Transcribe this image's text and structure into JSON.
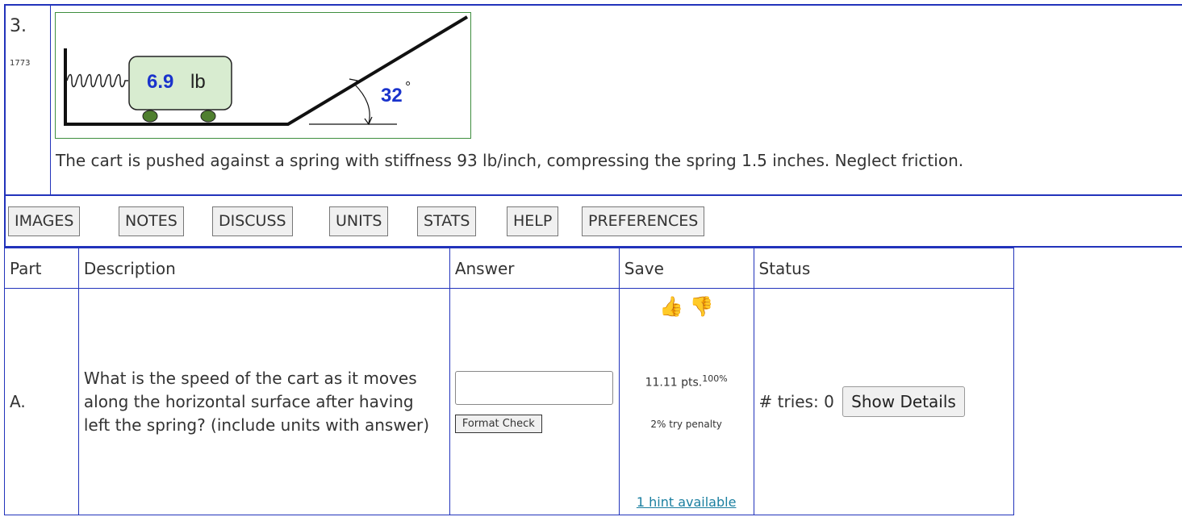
{
  "problem": {
    "number": "3.",
    "id": "1773",
    "figure": {
      "weight_value": "6.9",
      "weight_unit": "lb",
      "angle": "32",
      "angle_unit": "°"
    },
    "description": "The cart is pushed against a spring with stiffness 93 lb/inch, compressing the spring 1.5 inches. Neglect friction."
  },
  "toolbar": {
    "images": "IMAGES",
    "notes": "NOTES",
    "discuss": "DISCUSS",
    "units": "UNITS",
    "stats": "STATS",
    "help": "HELP",
    "preferences": "PREFERENCES"
  },
  "table": {
    "headers": {
      "part": "Part",
      "description": "Description",
      "answer": "Answer",
      "save": "Save",
      "status": "Status"
    },
    "row": {
      "part": "A.",
      "question": "What is the speed of the cart as it moves along the horizontal surface after having left the spring? (include units with answer)",
      "answer_value": "",
      "format_check": "Format Check",
      "points": "11.11 pts.",
      "points_percent": "100%",
      "penalty": "2% try penalty",
      "hint": "1 hint available",
      "tries": "# tries: 0",
      "show_details": "Show Details"
    }
  },
  "colors": {
    "border": "#2233bb",
    "angle_text": "#1a33cc",
    "thumb_up": "#3a9a3a",
    "thumb_down": "#d03030"
  }
}
